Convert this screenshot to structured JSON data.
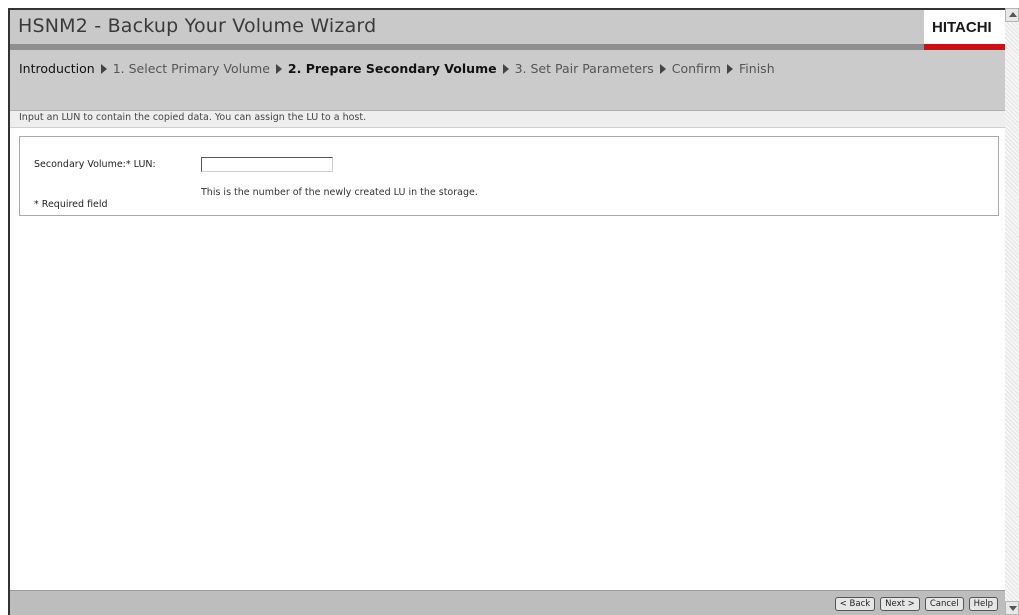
{
  "window": {
    "title": "HSNM2 - Backup Your Volume Wizard",
    "brand": "HITACHI"
  },
  "steps": [
    {
      "label": "Introduction",
      "state": "done"
    },
    {
      "label": "1. Select Primary Volume",
      "state": "todo"
    },
    {
      "label": "2. Prepare Secondary Volume",
      "state": "current"
    },
    {
      "label": "3. Set Pair Parameters",
      "state": "todo"
    },
    {
      "label": "Confirm",
      "state": "todo"
    },
    {
      "label": "Finish",
      "state": "todo"
    }
  ],
  "instruction": "Input an LUN to contain the copied data. You can assign the LU to a host.",
  "form": {
    "label": "Secondary Volume:* LUN:",
    "lun_value": "",
    "hint": "This is the number of the newly created LU in the storage.",
    "required_note": "* Required field"
  },
  "buttons": {
    "back": "< Back",
    "next": "Next >",
    "cancel": "Cancel",
    "help": "Help"
  },
  "colors": {
    "brand_red": "#d01010",
    "header_gray": "#c9c9c9"
  },
  "icons": {
    "step_separator": "triangle-right-icon",
    "scroll_up": "arrow-up-icon",
    "scroll_down": "arrow-down-icon"
  }
}
